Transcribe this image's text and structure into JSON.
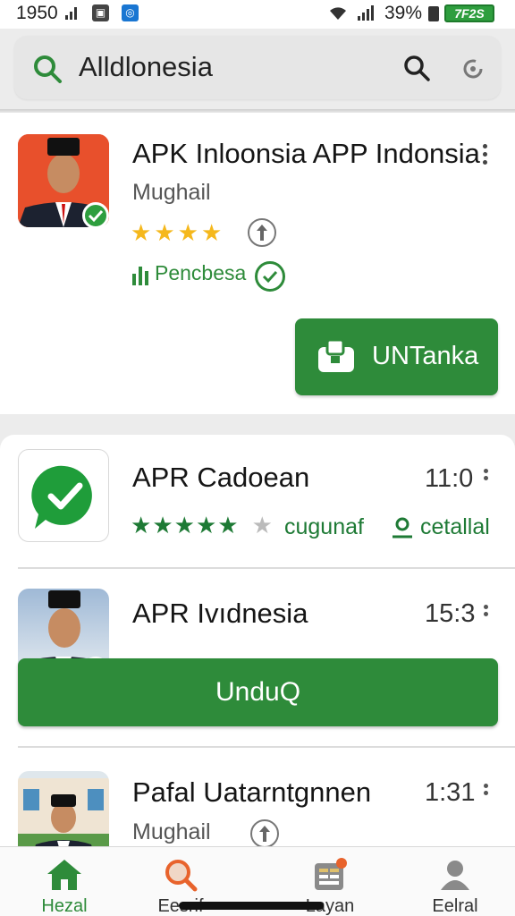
{
  "status_bar": {
    "time": "1950",
    "battery": "39%",
    "badge": "7F2S"
  },
  "search": {
    "query": "Alldlonesia"
  },
  "featured": {
    "title": "APK Inloonsia APP Indonsia",
    "author": "Mughail",
    "rating_stars": 4,
    "verified_label": "Pencbesa",
    "button_label": "UNTanka"
  },
  "list": [
    {
      "title": "APR Cadoean",
      "time": "11:0",
      "rating_stars": 5,
      "tag": "cugunaf",
      "action": "cetallal"
    },
    {
      "title": "APR Ivıdnesia",
      "time": "15:3",
      "button_label": "UnduQ"
    },
    {
      "title": "Pafal Uatarntgnnen",
      "time": "1:31",
      "author": "Mughail"
    }
  ],
  "nav": [
    {
      "label": "Hezal",
      "icon": "home-icon",
      "active": true
    },
    {
      "label": "Eesrif",
      "icon": "search-icon"
    },
    {
      "label": "Layan",
      "icon": "list-icon",
      "badge": "1"
    },
    {
      "label": "Eelral",
      "icon": "profile-icon"
    }
  ],
  "colors": {
    "accent": "#2e8b3a",
    "star": "#f5b81c"
  }
}
